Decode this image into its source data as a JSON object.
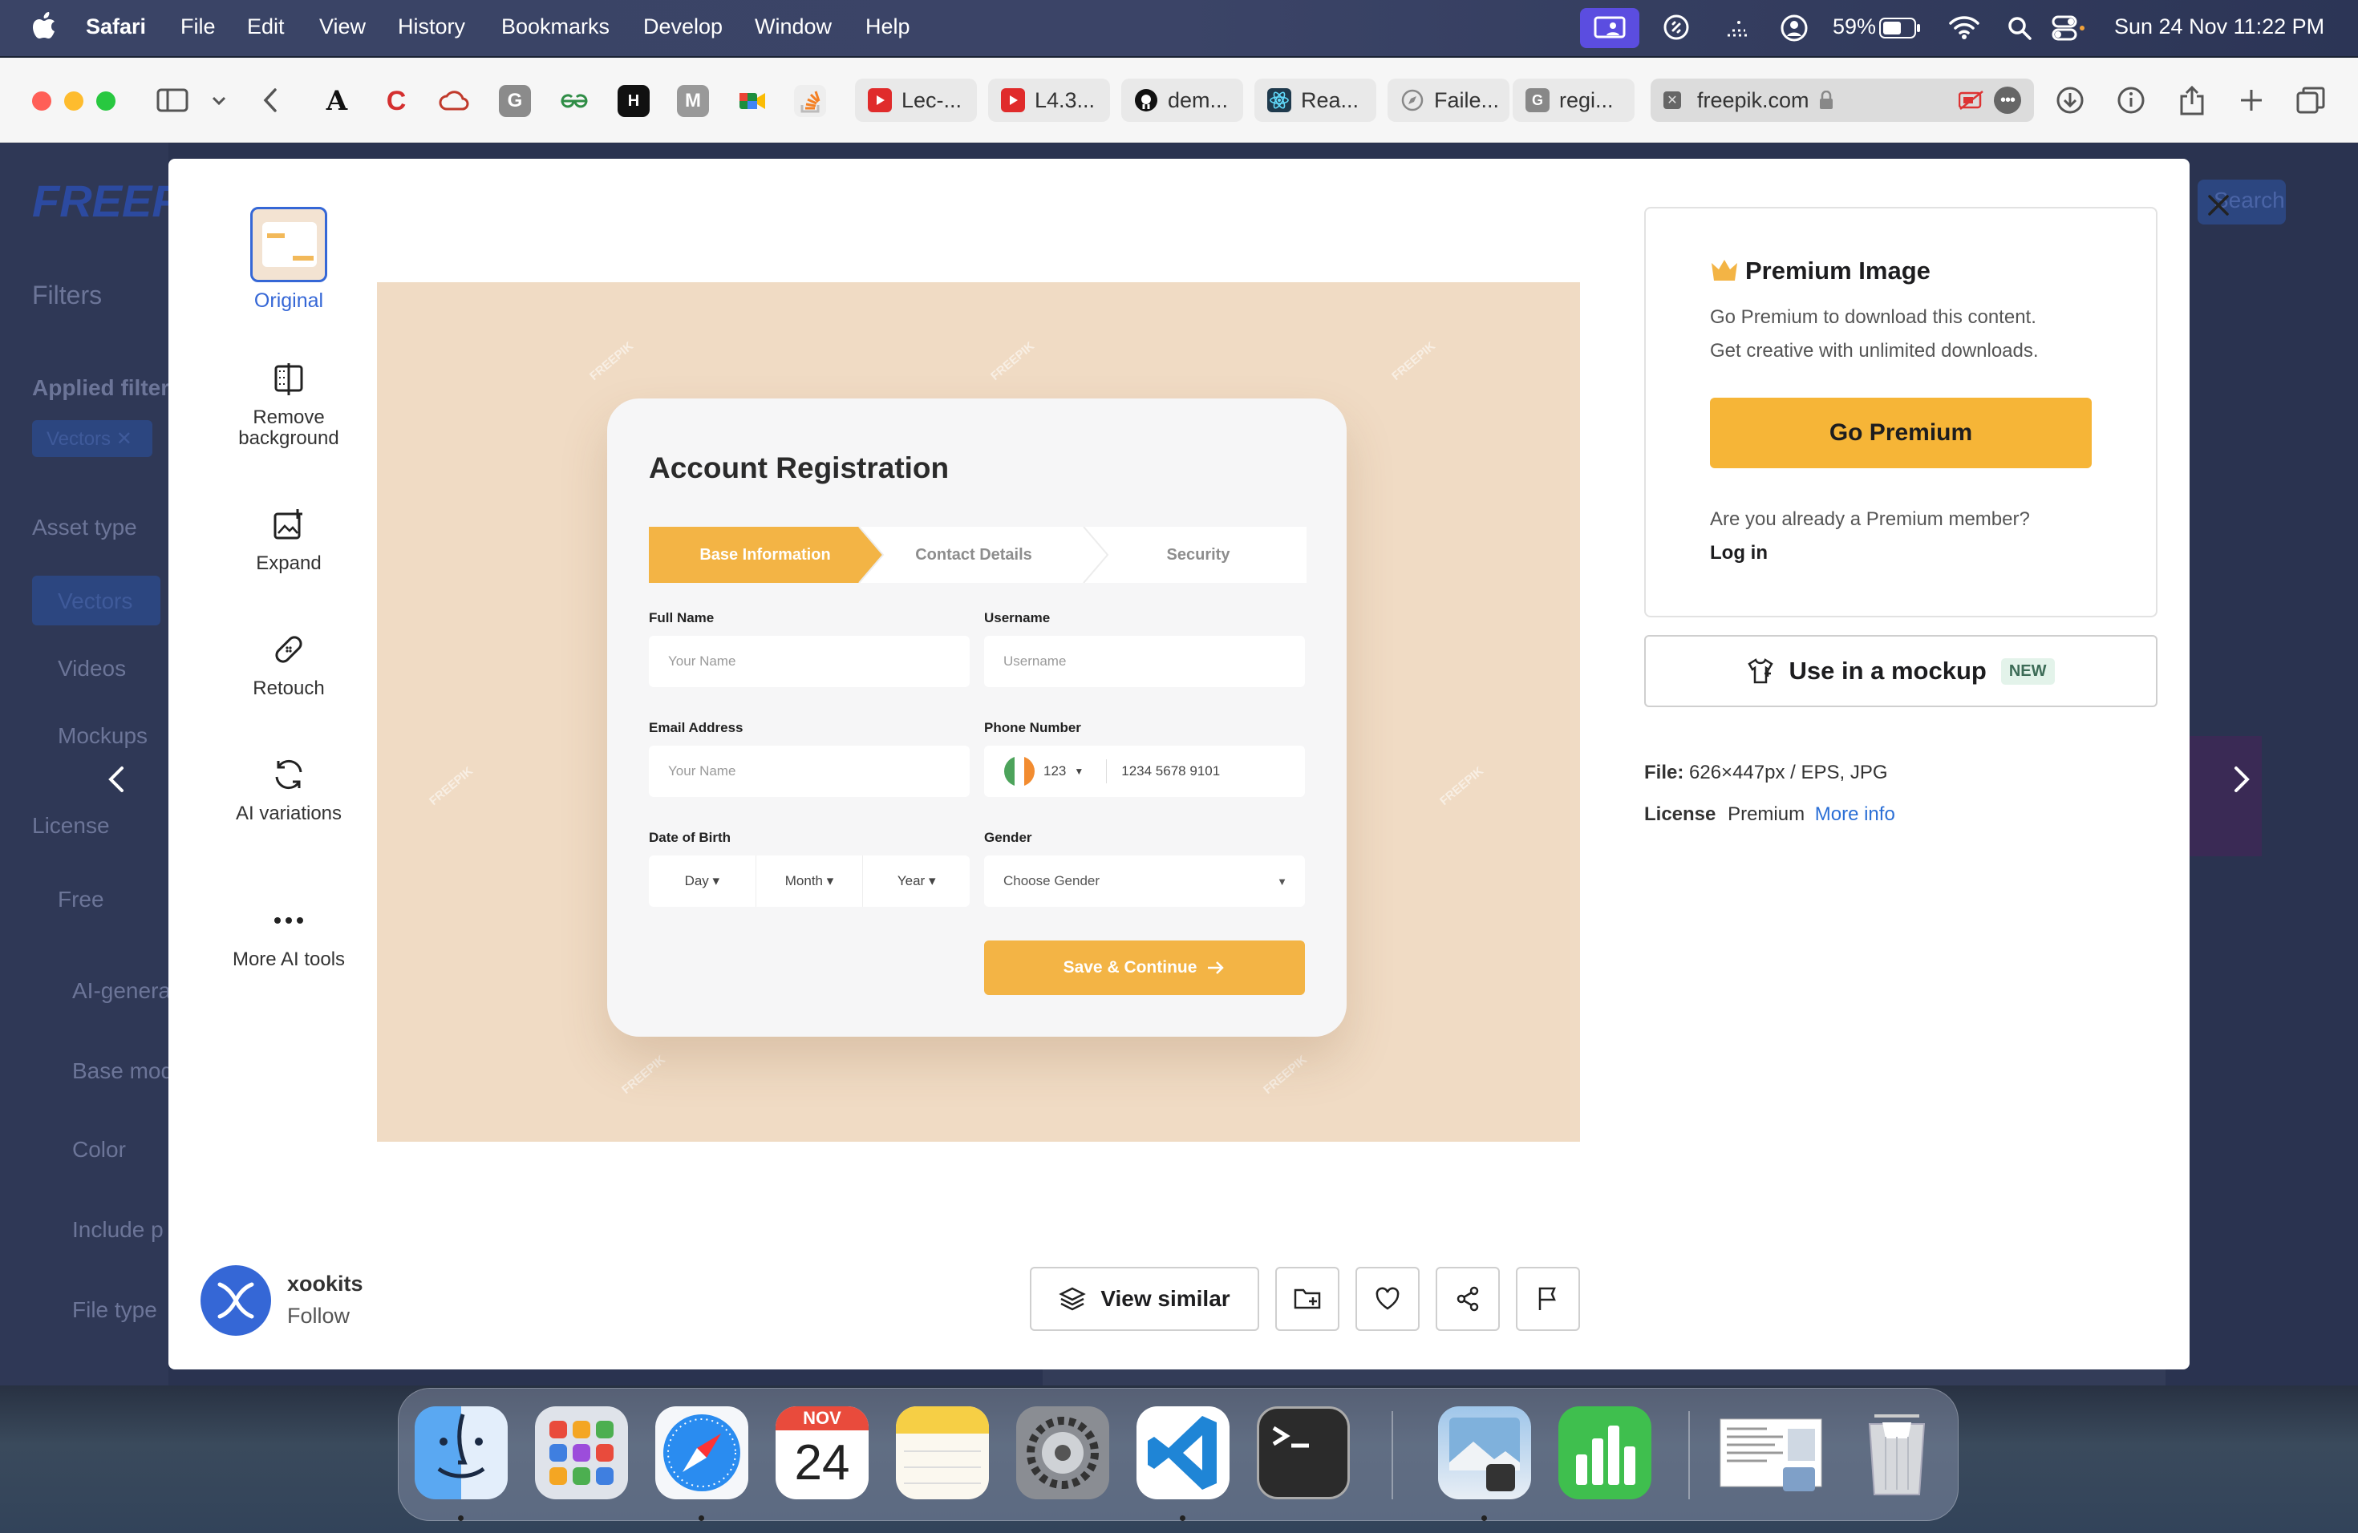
{
  "menubar": {
    "app": "Safari",
    "items": [
      "File",
      "Edit",
      "View",
      "History",
      "Bookmarks",
      "Develop",
      "Window",
      "Help"
    ],
    "battery": "59%",
    "datetime": "Sun 24 Nov  11:22 PM"
  },
  "toolbar": {
    "tabs": [
      "Lec-...",
      "L4.3...",
      "dem...",
      "Rea...",
      "Faile...",
      "regi..."
    ],
    "address": "freepik.com"
  },
  "background": {
    "logo": "FREEP",
    "filters": "Filters",
    "applied": "Applied filters",
    "chip": "Vectors ✕",
    "asset_type": "Asset type",
    "vectors": "Vectors",
    "videos": "Videos",
    "mockups": "Mockups",
    "license": "License",
    "free": "Free",
    "ai_generated": "AI-generated",
    "base_model": "Base model",
    "color": "Color",
    "include": "Include p",
    "file_type": "File type",
    "search": "Search"
  },
  "sidebar_tools": {
    "original": "Original",
    "remove_bg": "Remove background",
    "expand": "Expand",
    "retouch": "Retouch",
    "ai_variations": "AI variations",
    "more_ai": "More AI tools"
  },
  "preview": {
    "watermark": "FREEPIK",
    "title": "Account Registration",
    "steps": [
      "Base Information",
      "Contact Details",
      "Security"
    ],
    "full_name_label": "Full Name",
    "full_name_placeholder": "Your Name",
    "username_label": "Username",
    "username_placeholder": "Username",
    "email_label": "Email Address",
    "email_placeholder": "Your Name",
    "phone_label": "Phone Number",
    "phone_code": "123",
    "phone_placeholder": "1234 5678 9101",
    "dob_label": "Date of Birth",
    "day": "Day",
    "month": "Month",
    "year": "Year",
    "gender_label": "Gender",
    "gender_placeholder": "Choose Gender",
    "submit": "Save & Continue"
  },
  "premium": {
    "title": "Premium Image",
    "line1": "Go Premium to download this content.",
    "line2": "Get creative with unlimited downloads.",
    "button": "Go Premium",
    "member_q": "Are you already a Premium member?",
    "login": "Log in"
  },
  "mockup": {
    "label": "Use in a mockup",
    "badge": "NEW"
  },
  "file_info": {
    "file_label": "File:",
    "file_value": "626×447px / EPS, JPG",
    "license_label": "License",
    "license_value": "Premium",
    "more_info": "More info"
  },
  "author": {
    "name": "xookits",
    "follow": "Follow"
  },
  "actions": {
    "view_similar": "View similar"
  },
  "dock": {
    "calendar_month": "NOV",
    "calendar_day": "24"
  },
  "colors": {
    "accent": "#f6b537",
    "link": "#2b6fd6",
    "original_blue": "#3567d6"
  }
}
